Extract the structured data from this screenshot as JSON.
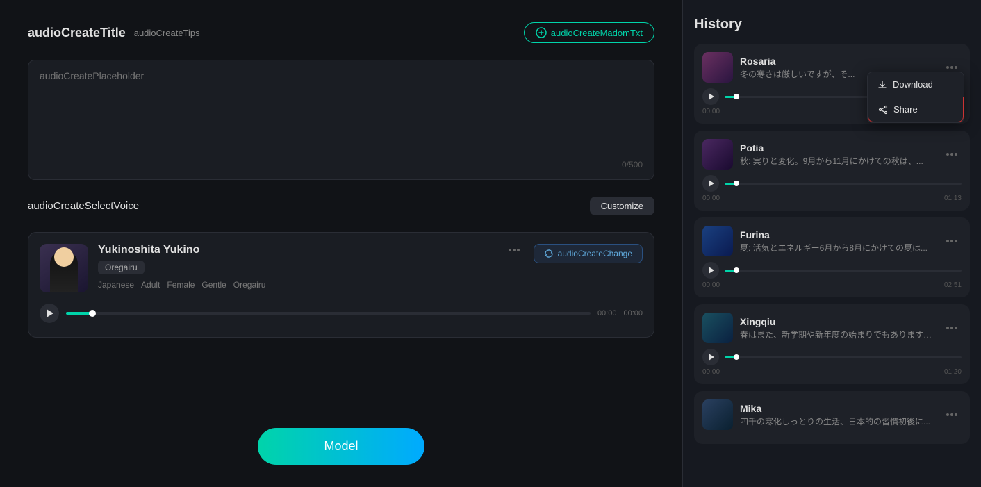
{
  "left": {
    "title": "audioCreateTitle",
    "tips": "audioCreateTips",
    "madom_btn": "audioCreateMadomTxt",
    "textarea_placeholder": "audioCreatePlaceholder",
    "char_count": "0/500",
    "select_voice_label": "audioCreateSelectVoice",
    "customize_btn": "Customize",
    "voice": {
      "name": "Yukinoshita Yukino",
      "tag": "Oregairu",
      "props": [
        "Japanese",
        "Adult",
        "Female",
        "Gentle",
        "Oregairu"
      ],
      "change_btn": "audioCreateChange",
      "time_start": "00:00",
      "time_end": "00:00"
    },
    "model_btn": "Model"
  },
  "right": {
    "title": "History",
    "items": [
      {
        "name": "Rosaria",
        "text": "冬の寒さは厳しいですが、そ...",
        "time_start": "00:00",
        "time_end": "",
        "avatar_class": "hist-av-rosaria",
        "show_dropdown": true
      },
      {
        "name": "Potia",
        "text": "秋: 実りと変化。9月から11月にかけての秋は、...",
        "time_start": "00:00",
        "time_end": "01:13",
        "avatar_class": "hist-av-potia",
        "show_dropdown": false
      },
      {
        "name": "Furina",
        "text": "夏: 活気とエネルギー6月から8月にかけての夏は...",
        "time_start": "00:00",
        "time_end": "02:51",
        "avatar_class": "hist-av-furina",
        "show_dropdown": false
      },
      {
        "name": "Xingqiu",
        "text": "春はまた、新学期や新年度の始まりでもありまする...",
        "time_start": "00:00",
        "time_end": "01:20",
        "avatar_class": "hist-av-xingqiu",
        "show_dropdown": false
      },
      {
        "name": "Mika",
        "text": "四千の寒化しっとりの生活、日本的の習慣初後に...",
        "time_start": "",
        "time_end": "",
        "avatar_class": "hist-av-mika",
        "show_dropdown": false
      }
    ],
    "dropdown": {
      "download": "Download",
      "share": "Share"
    }
  }
}
